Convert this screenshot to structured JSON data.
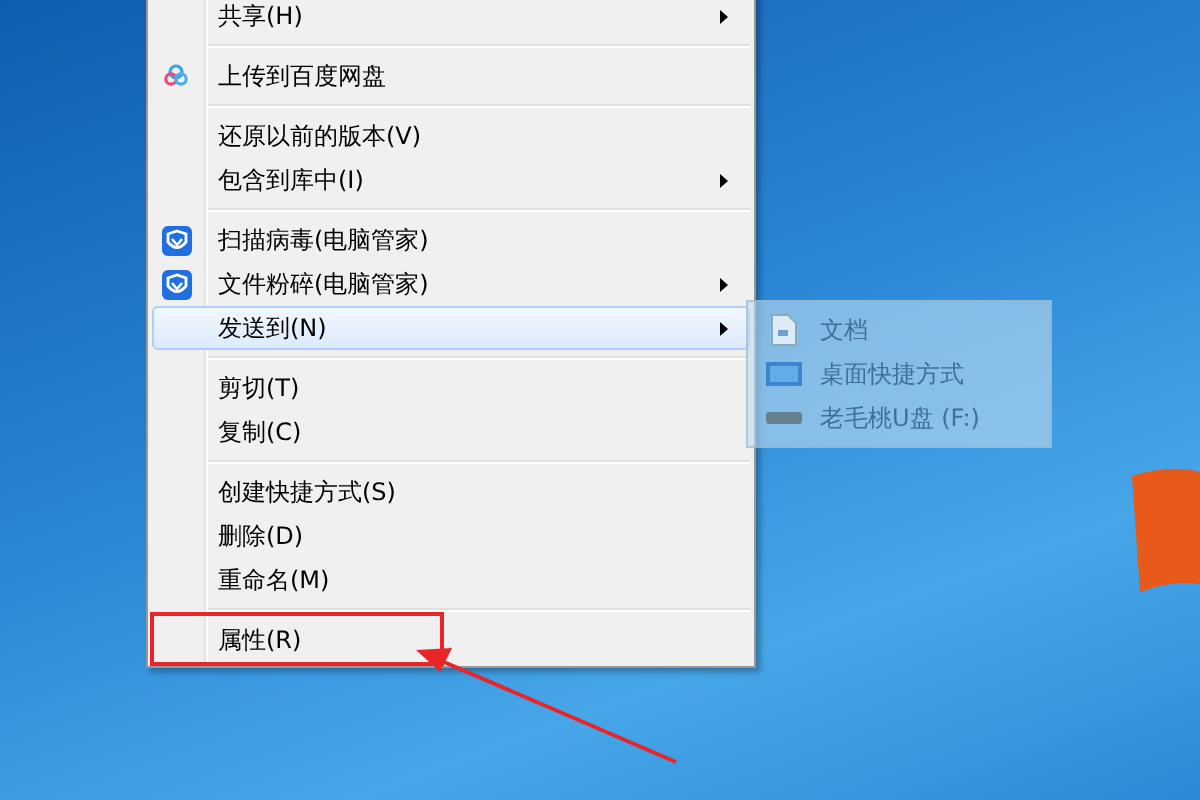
{
  "context_menu": {
    "items": [
      {
        "kind": "item",
        "label": "共享(H)",
        "has_submenu": true,
        "selected": false,
        "annotated": false
      },
      {
        "kind": "separator"
      },
      {
        "kind": "cloud",
        "label": "上传到百度网盘",
        "has_submenu": false,
        "selected": false,
        "annotated": false
      },
      {
        "kind": "separator"
      },
      {
        "kind": "item",
        "label": "还原以前的版本(V)",
        "has_submenu": false,
        "selected": false,
        "annotated": false
      },
      {
        "kind": "item",
        "label": "包含到库中(I)",
        "has_submenu": true,
        "selected": false,
        "annotated": false
      },
      {
        "kind": "separator"
      },
      {
        "kind": "shield",
        "label": "扫描病毒(电脑管家)",
        "has_submenu": false,
        "selected": false,
        "annotated": false
      },
      {
        "kind": "shield",
        "label": "文件粉碎(电脑管家)",
        "has_submenu": true,
        "selected": false,
        "annotated": false
      },
      {
        "kind": "item",
        "label": "发送到(N)",
        "has_submenu": true,
        "selected": true,
        "annotated": false
      },
      {
        "kind": "separator"
      },
      {
        "kind": "item",
        "label": "剪切(T)",
        "has_submenu": false,
        "selected": false,
        "annotated": false
      },
      {
        "kind": "item",
        "label": "复制(C)",
        "has_submenu": false,
        "selected": false,
        "annotated": false
      },
      {
        "kind": "separator"
      },
      {
        "kind": "item",
        "label": "创建快捷方式(S)",
        "has_submenu": false,
        "selected": false,
        "annotated": false
      },
      {
        "kind": "item",
        "label": "删除(D)",
        "has_submenu": false,
        "selected": false,
        "annotated": false
      },
      {
        "kind": "item",
        "label": "重命名(M)",
        "has_submenu": false,
        "selected": false,
        "annotated": false
      },
      {
        "kind": "separator"
      },
      {
        "kind": "item",
        "label": "属性(R)",
        "has_submenu": false,
        "selected": false,
        "annotated": true
      }
    ]
  },
  "submenu": {
    "items": [
      {
        "kind": "document",
        "label": "文档"
      },
      {
        "kind": "monitor",
        "label": "桌面快捷方式"
      },
      {
        "kind": "drive",
        "label": "老毛桃U盘 (F:)"
      }
    ]
  }
}
